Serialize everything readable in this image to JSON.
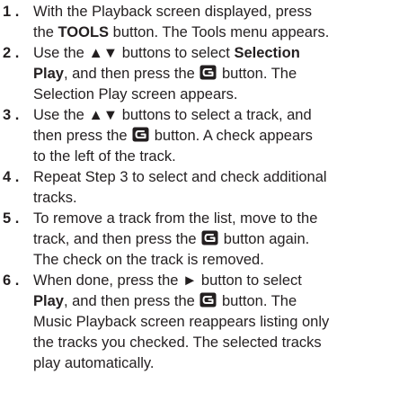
{
  "steps": [
    {
      "number": "1 .",
      "lines": [
        [
          {
            "t": "With the Playback screen displayed, press"
          }
        ],
        [
          {
            "t": "the "
          },
          {
            "t": "TOOLS",
            "b": true
          },
          {
            "t": " button. The Tools menu appears."
          }
        ]
      ]
    },
    {
      "number": "2 .",
      "lines": [
        [
          {
            "t": "Use the ▲▼ buttons to select "
          },
          {
            "t": "Selection",
            "b": true
          }
        ],
        [
          {
            "t": "Play",
            "b": true
          },
          {
            "t": ", and then press the "
          },
          {
            "icon": "enter-button-icon"
          },
          {
            "t": " button. The"
          }
        ],
        [
          {
            "t": "Selection Play screen appears."
          }
        ]
      ]
    },
    {
      "number": "3 .",
      "lines": [
        [
          {
            "t": "Use the ▲▼ buttons to select a track, and"
          }
        ],
        [
          {
            "t": "then press the "
          },
          {
            "icon": "enter-button-icon"
          },
          {
            "t": " button. A check appears"
          }
        ],
        [
          {
            "t": "to the left of the track."
          }
        ]
      ]
    },
    {
      "number": "4 .",
      "lines": [
        [
          {
            "t": "Repeat Step 3 to select and check additional"
          }
        ],
        [
          {
            "t": "tracks."
          }
        ]
      ]
    },
    {
      "number": "5 .",
      "lines": [
        [
          {
            "t": "To remove a track from the list, move to the"
          }
        ],
        [
          {
            "t": "track, and then press the "
          },
          {
            "icon": "enter-button-icon"
          },
          {
            "t": " button again."
          }
        ],
        [
          {
            "t": "The check on the track is removed."
          }
        ]
      ]
    },
    {
      "number": "6 .",
      "lines": [
        [
          {
            "t": "When done, press the ► button to select"
          }
        ],
        [
          {
            "t": "Play",
            "b": true
          },
          {
            "t": ", and then press the "
          },
          {
            "icon": "enter-button-icon"
          },
          {
            "t": " button. The"
          }
        ],
        [
          {
            "t": "Music Playback screen reappears listing only"
          }
        ],
        [
          {
            "t": "the tracks you checked. The selected tracks"
          }
        ],
        [
          {
            "t": "play automatically."
          }
        ]
      ]
    }
  ],
  "colors": {
    "text": "#231f20",
    "icon_fill": "#231f20",
    "icon_glyph": "#ffffff"
  }
}
